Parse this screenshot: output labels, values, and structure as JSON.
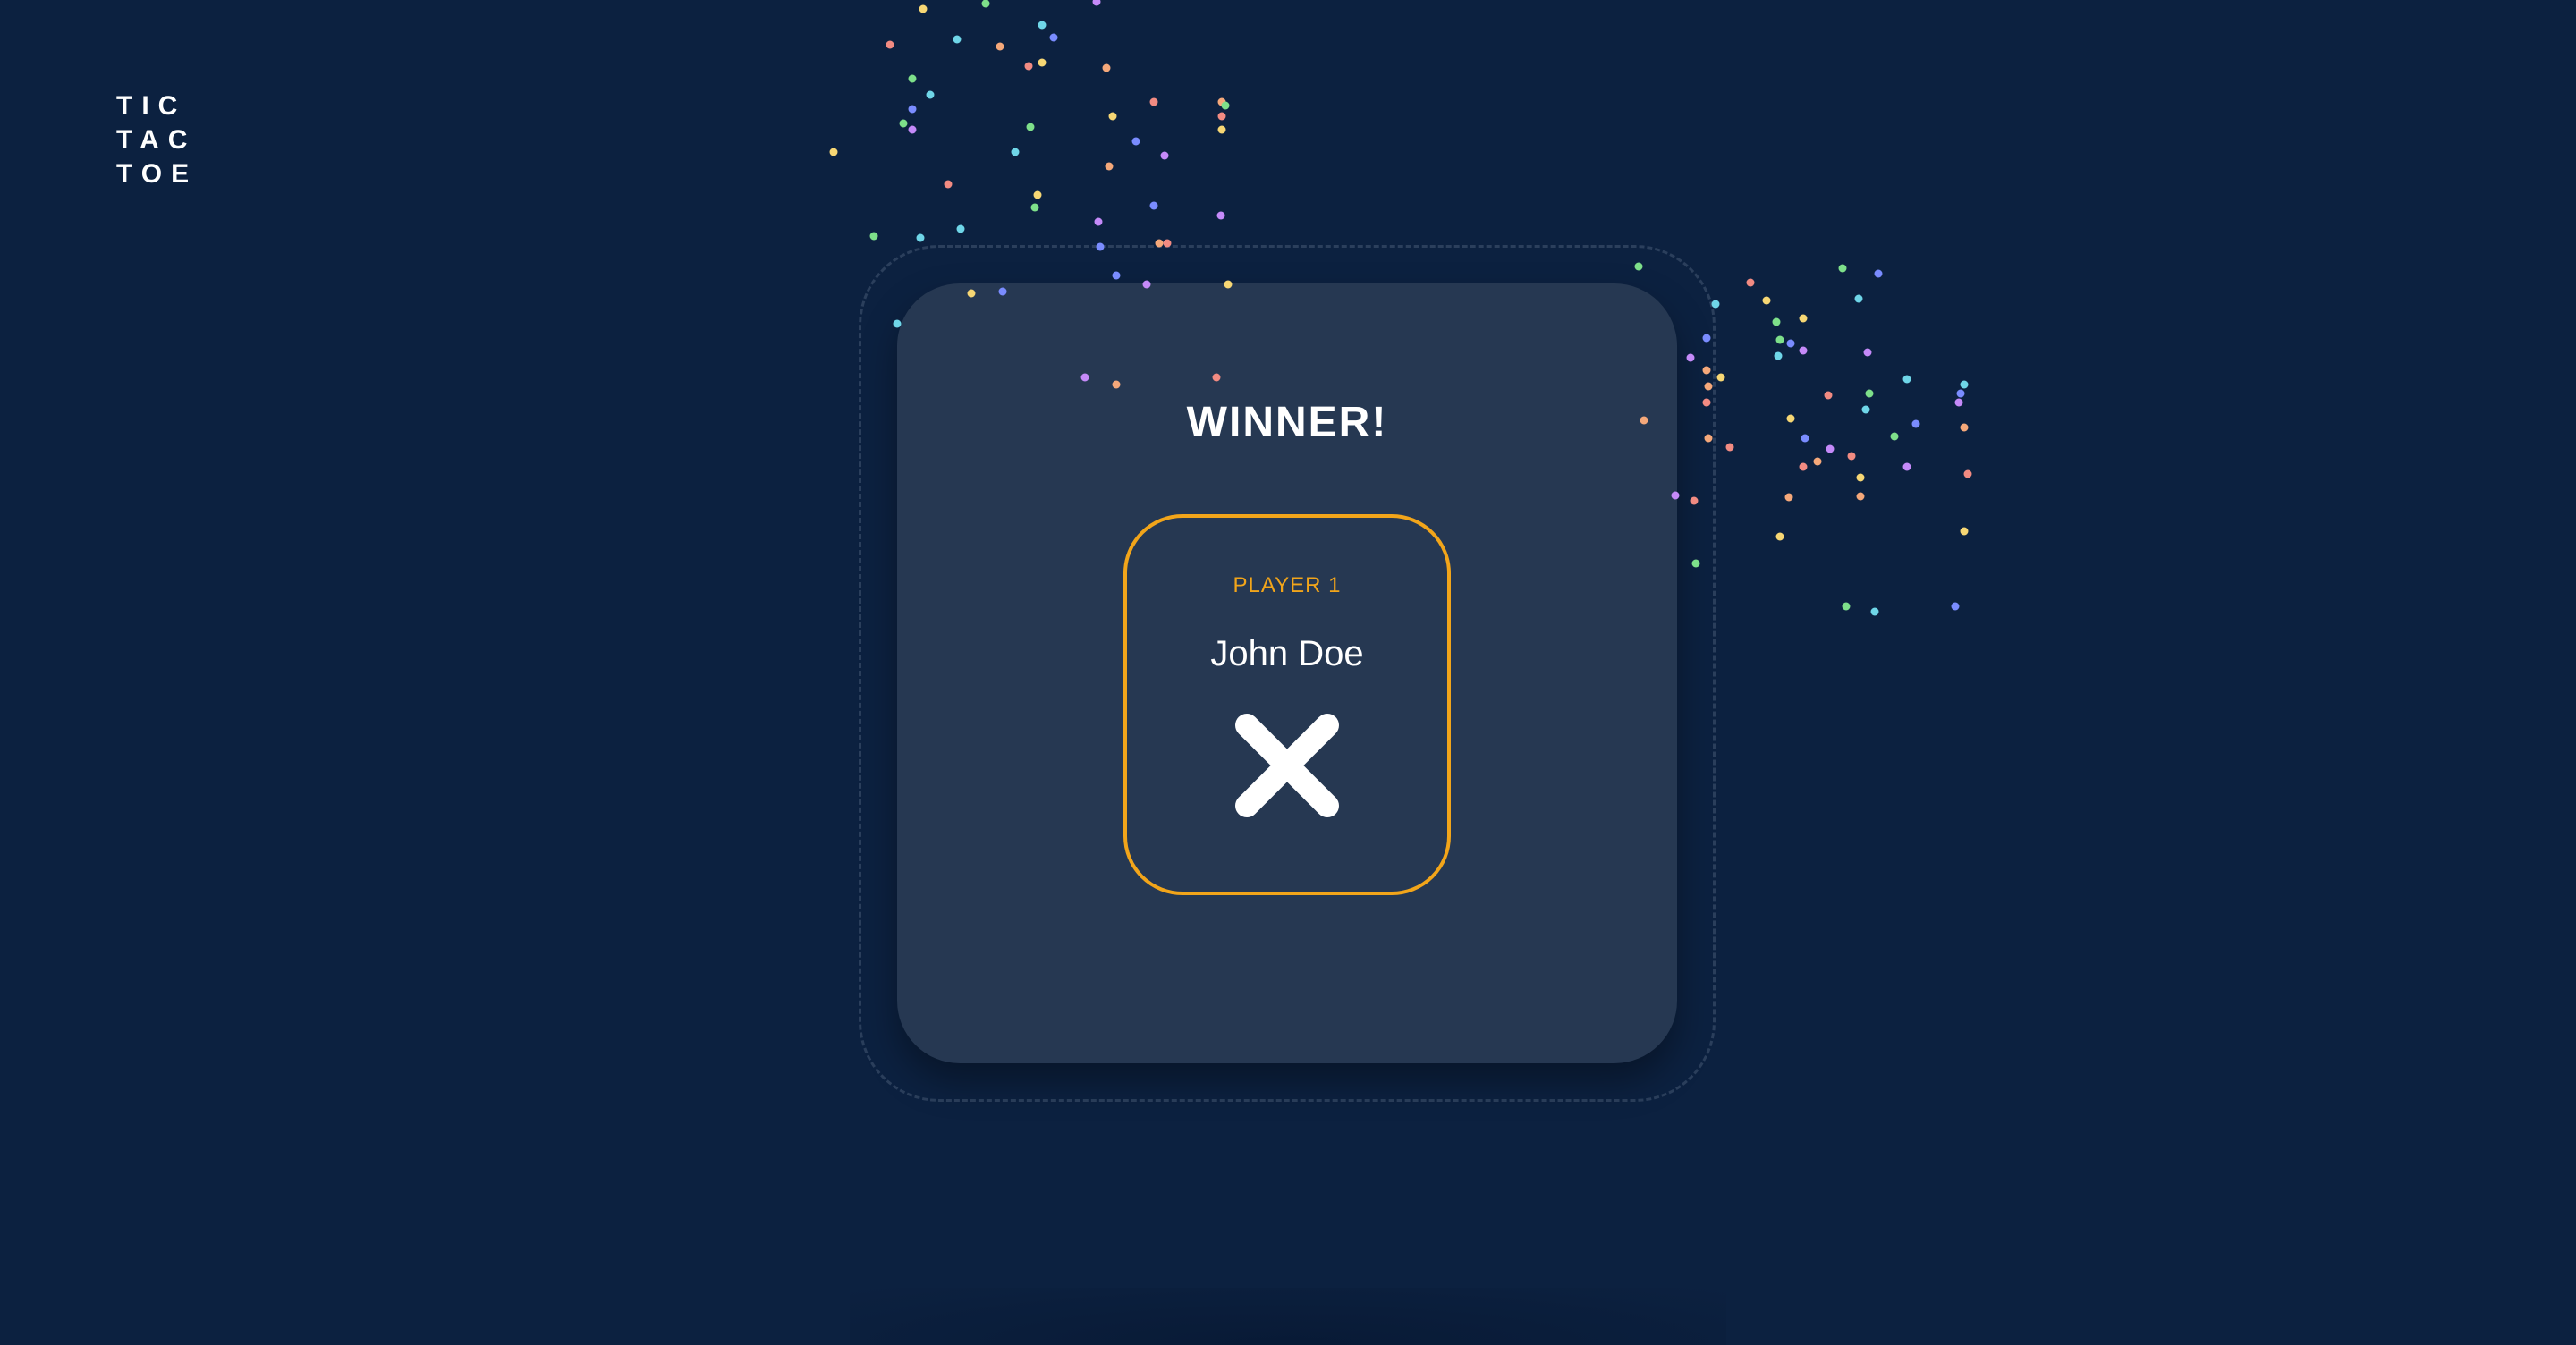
{
  "logo": {
    "line1": "TIC",
    "line2": "TAC",
    "line3": "TOE"
  },
  "result": {
    "title": "WINNER!",
    "player_label": "PLAYER 1",
    "player_name": "John Doe",
    "winner_mark": "x-mark-icon"
  },
  "colors": {
    "background": "#0c2140",
    "modal": "#263852",
    "accent": "#f2a51a",
    "text": "#ffffff",
    "confetti": [
      "#f28b82",
      "#f7d774",
      "#7ee08a",
      "#6fd6e8",
      "#7a8cff",
      "#c58af9",
      "#f5a87a"
    ]
  }
}
